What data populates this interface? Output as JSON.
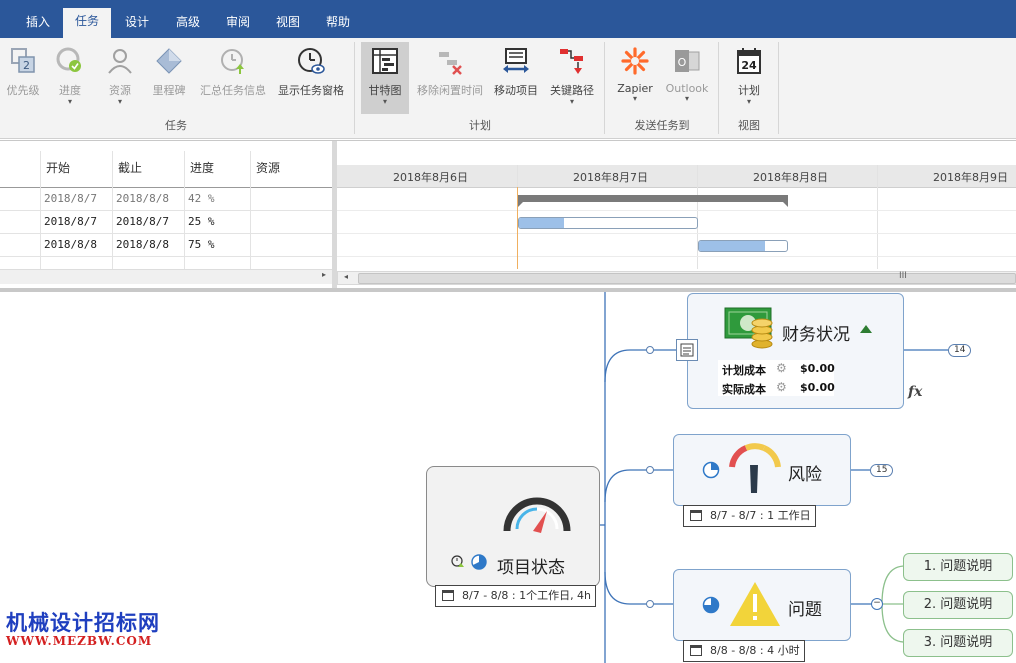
{
  "tabs": [
    {
      "label": "插入"
    },
    {
      "label": "任务",
      "active": true
    },
    {
      "label": "设计"
    },
    {
      "label": "高级"
    },
    {
      "label": "审阅"
    },
    {
      "label": "视图"
    },
    {
      "label": "帮助"
    }
  ],
  "ribbon": {
    "task_group": {
      "label": "任务",
      "priority": "优先级",
      "progress": "进度",
      "resource": "资源",
      "milestone": "里程碑",
      "summary_info": "汇总任务信息",
      "show_pane": "显示任务窗格"
    },
    "plan_group": {
      "label": "计划",
      "gantt": "甘特图",
      "remove_idle": "移除闲置时间",
      "move_item": "移动项目",
      "critical_path": "关键路径"
    },
    "send_group": {
      "label": "发送任务到",
      "zapier": "Zapier",
      "outlook": "Outlook"
    },
    "view_group": {
      "label": "视图",
      "plan": "计划",
      "calendar_day": "24"
    }
  },
  "gantt": {
    "columns": [
      "开始",
      "截止",
      "进度",
      "资源"
    ],
    "rows": [
      {
        "start": "2018/8/7",
        "end": "2018/8/8",
        "progress": "42 %",
        "progress_value": 42,
        "resource": ""
      },
      {
        "start": "2018/8/7",
        "end": "2018/8/7",
        "progress": "25 %",
        "progress_value": 25,
        "resource": ""
      },
      {
        "start": "2018/8/8",
        "end": "2018/8/8",
        "progress": "75 %",
        "progress_value": 75,
        "resource": ""
      }
    ],
    "dates": [
      "2018年8月6日",
      "2018年8月7日",
      "2018年8月8日",
      "2018年8月9日"
    ],
    "scroll_grip": "III"
  },
  "mindmap": {
    "root": {
      "title": "项目状态",
      "date": "8/7 - 8/8 : 1个工作日, 4h"
    },
    "finance": {
      "title": "财务状况",
      "planned_label": "计划成本",
      "planned_value": "$0.00",
      "actual_label": "实际成本",
      "actual_value": "$0.00",
      "badge": "14",
      "fx": "fx"
    },
    "risk": {
      "title": "风险",
      "date": "8/7 - 8/7 : 1 工作日",
      "badge": "15"
    },
    "issue": {
      "title": "问题",
      "date": "8/8 - 8/8 : 4 小时",
      "children": [
        "1. 问题说明",
        "2. 问题说明",
        "3. 问题说明"
      ]
    }
  },
  "watermark": {
    "line1": "机械设计招标网",
    "line2": "WWW.MEZBW.COM"
  },
  "colors": {
    "ribbon_blue": "#2b579a",
    "bar_fill": "#9dc0e8",
    "node_border": "#7fa3cc",
    "leaf_border": "#8cc08c"
  }
}
